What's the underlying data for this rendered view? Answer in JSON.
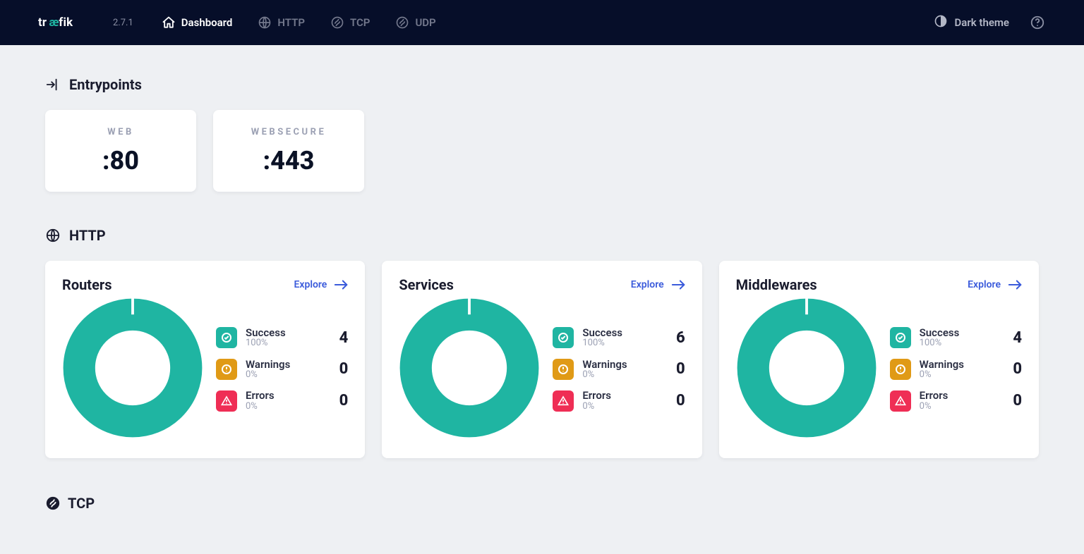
{
  "nav": {
    "brand": "træfik",
    "version": "2.7.1",
    "tabs": [
      {
        "key": "dashboard",
        "label": "Dashboard",
        "active": true
      },
      {
        "key": "http",
        "label": "HTTP",
        "active": false
      },
      {
        "key": "tcp",
        "label": "TCP",
        "active": false
      },
      {
        "key": "udp",
        "label": "UDP",
        "active": false
      }
    ],
    "theme_label": "Dark theme"
  },
  "sections": {
    "entrypoints": {
      "title": "Entrypoints",
      "items": [
        {
          "name": "WEB",
          "port": ":80"
        },
        {
          "name": "WEBSECURE",
          "port": ":443"
        }
      ]
    },
    "http": {
      "title": "HTTP",
      "explore_label": "Explore",
      "stat_labels": {
        "success": "Success",
        "warnings": "Warnings",
        "errors": "Errors"
      },
      "panels": [
        {
          "title": "Routers",
          "success": {
            "pct": "100%",
            "count": "4"
          },
          "warnings": {
            "pct": "0%",
            "count": "0"
          },
          "errors": {
            "pct": "0%",
            "count": "0"
          }
        },
        {
          "title": "Services",
          "success": {
            "pct": "100%",
            "count": "6"
          },
          "warnings": {
            "pct": "0%",
            "count": "0"
          },
          "errors": {
            "pct": "0%",
            "count": "0"
          }
        },
        {
          "title": "Middlewares",
          "success": {
            "pct": "100%",
            "count": "4"
          },
          "warnings": {
            "pct": "0%",
            "count": "0"
          },
          "errors": {
            "pct": "0%",
            "count": "0"
          }
        }
      ]
    },
    "tcp": {
      "title": "TCP"
    }
  },
  "chart_data": [
    {
      "type": "pie",
      "title": "Routers",
      "categories": [
        "Success",
        "Warnings",
        "Errors"
      ],
      "values": [
        4,
        0,
        0
      ],
      "colors": [
        "#1fb5a2",
        "#e09a16",
        "#ef2e55"
      ]
    },
    {
      "type": "pie",
      "title": "Services",
      "categories": [
        "Success",
        "Warnings",
        "Errors"
      ],
      "values": [
        6,
        0,
        0
      ],
      "colors": [
        "#1fb5a2",
        "#e09a16",
        "#ef2e55"
      ]
    },
    {
      "type": "pie",
      "title": "Middlewares",
      "categories": [
        "Success",
        "Warnings",
        "Errors"
      ],
      "values": [
        4,
        0,
        0
      ],
      "colors": [
        "#1fb5a2",
        "#e09a16",
        "#ef2e55"
      ]
    }
  ]
}
